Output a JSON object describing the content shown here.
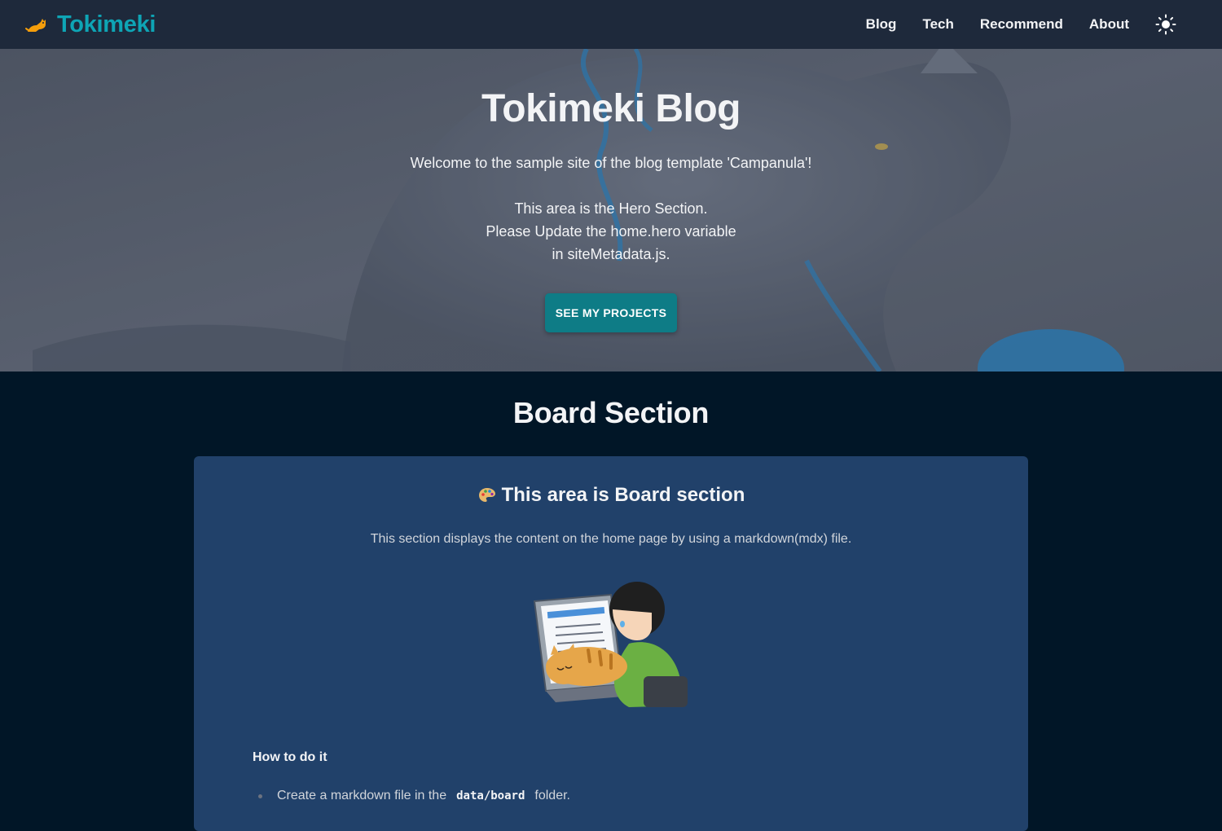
{
  "header": {
    "brand": "Tokimeki",
    "nav": {
      "blog": "Blog",
      "tech": "Tech",
      "recommend": "Recommend",
      "about": "About"
    },
    "theme_icon": "sun-icon"
  },
  "hero": {
    "title": "Tokimeki Blog",
    "welcome": "Welcome to the sample site of the blog template 'Campanula'!",
    "line1": "This area is the Hero Section.",
    "line2": "Please Update the home.hero variable",
    "line3": "in siteMetadata.js.",
    "button": "SEE MY PROJECTS"
  },
  "board": {
    "heading": "Board Section",
    "card_title": "This area is Board section",
    "card_icon": "palette-icon",
    "description": "This section displays the content on the home page by using a markdown(mdx) file.",
    "howto": "How to do it",
    "step1": {
      "before": "Create a markdown file in the",
      "code": "data/board",
      "after": "folder."
    }
  },
  "colors": {
    "header_bg": "#1e293b",
    "page_bg": "#011627",
    "brand": "#0ea5b5",
    "button": "#0e7c86",
    "card_bg": "#21416a"
  }
}
